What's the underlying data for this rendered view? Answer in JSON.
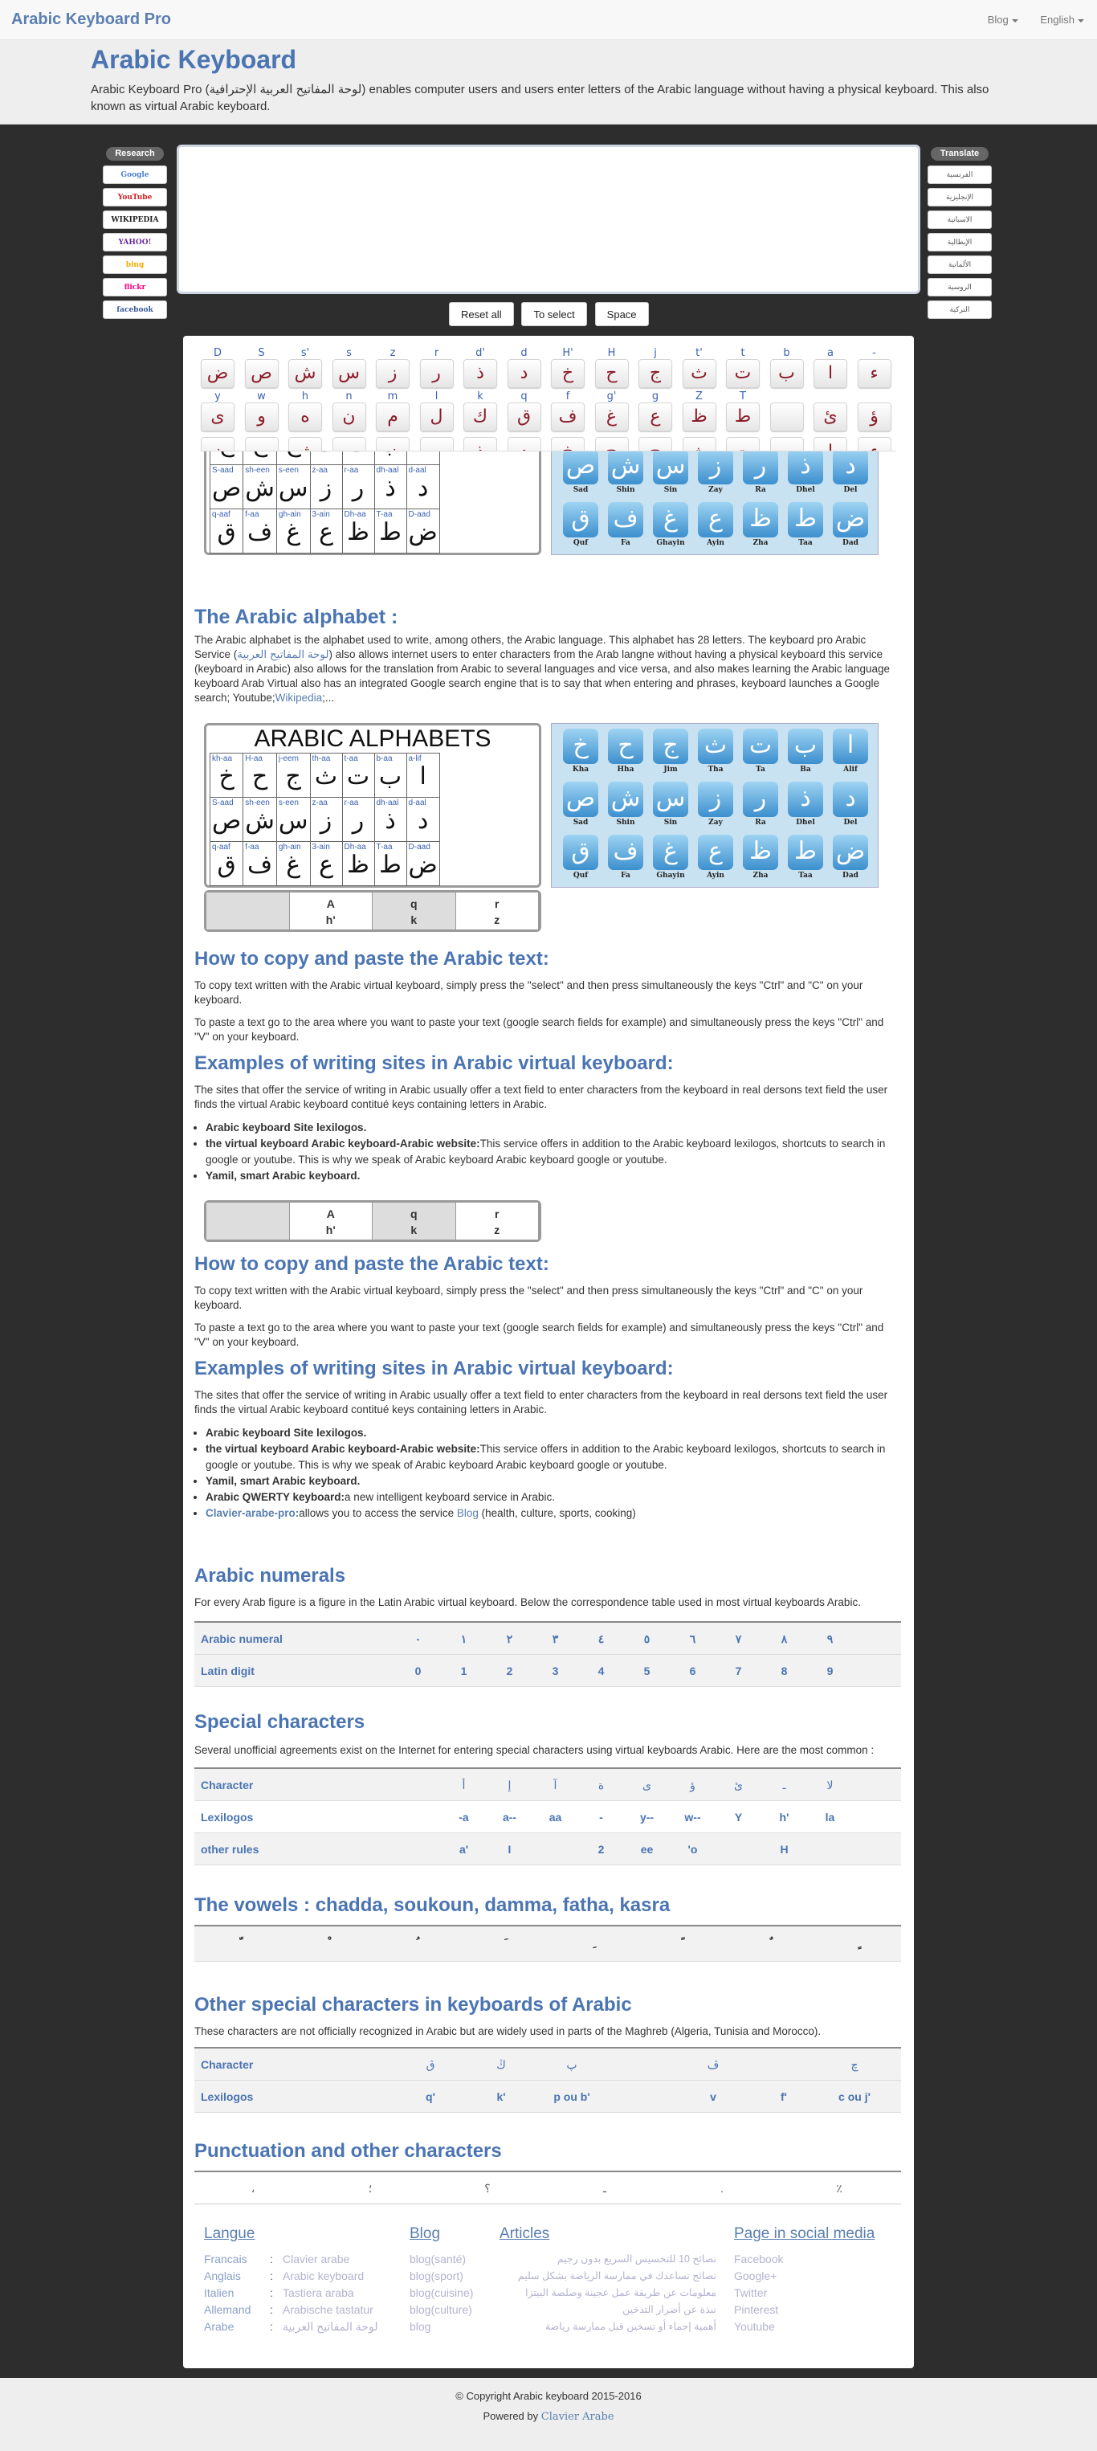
{
  "nav": {
    "brand": "Arabic Keyboard Pro",
    "blog": "Blog",
    "lang": "English"
  },
  "hero": {
    "title": "Arabic Keyboard",
    "desc": "Arabic Keyboard Pro (لوحة المفاتيح العربية الإحترافية) enables computer users and users enter letters of the Arabic language without having a physical keyboard. This also known as virtual Arabic keyboard."
  },
  "research": {
    "label": "Research",
    "items": [
      "Google",
      "YouTube",
      "WIKIPEDIA",
      "YAHOO!",
      "bing",
      "flickr",
      "facebook"
    ]
  },
  "translate": {
    "label": "Translate",
    "items": [
      "الفرنسية",
      "الإنجليزية",
      "الاسبانية",
      "الإيطالية",
      "الألمانية",
      "الروسية",
      "التركية"
    ]
  },
  "buttons": {
    "reset": "Reset all",
    "select": "To select",
    "space": "Space"
  },
  "keyboard": {
    "row1": [
      [
        "D",
        "ض"
      ],
      [
        "S",
        "ص"
      ],
      [
        "s'",
        "ش"
      ],
      [
        "s",
        "س"
      ],
      [
        "z",
        "ز"
      ],
      [
        "r",
        "ر"
      ],
      [
        "d'",
        "ذ"
      ],
      [
        "d",
        "د"
      ],
      [
        "H'",
        "خ"
      ],
      [
        "H",
        "ح"
      ],
      [
        "j",
        "ج"
      ],
      [
        "t'",
        "ث"
      ],
      [
        "t",
        "ت"
      ],
      [
        "b",
        "ب"
      ],
      [
        "a",
        "ا"
      ],
      [
        "-",
        "ء"
      ]
    ],
    "row2": [
      [
        "y",
        "ى"
      ],
      [
        "w",
        "و"
      ],
      [
        "h",
        "ه"
      ],
      [
        "n",
        "ن"
      ],
      [
        "m",
        "م"
      ],
      [
        "l",
        "ل"
      ],
      [
        "k",
        "ك"
      ],
      [
        "q",
        "ق"
      ],
      [
        "f",
        "ف"
      ],
      [
        "g'",
        "غ"
      ],
      [
        "g",
        "ع"
      ],
      [
        "Z",
        "ظ"
      ],
      [
        "T",
        "ط"
      ],
      [
        "",
        ""
      ],
      [
        "",
        "ئ"
      ],
      [
        "",
        "ؤ"
      ]
    ]
  },
  "alphabet_img": {
    "title": "ARABIC ALPHABETS",
    "rows": [
      [
        [
          "kh-aa",
          "خ"
        ],
        [
          "H-aa",
          "ح"
        ],
        [
          "j-eem",
          "ج"
        ],
        [
          "th-aa",
          "ث"
        ],
        [
          "t-aa",
          "ت"
        ],
        [
          "b-aa",
          "ب"
        ],
        [
          "a-lif",
          "ا"
        ]
      ],
      [
        [
          "S-aad",
          "ص"
        ],
        [
          "sh-een",
          "ش"
        ],
        [
          "s-een",
          "س"
        ],
        [
          "z-aa",
          "ز"
        ],
        [
          "r-aa",
          "ر"
        ],
        [
          "dh-aal",
          "ذ"
        ],
        [
          "d-aal",
          "د"
        ]
      ],
      [
        [
          "q-aaf",
          "ق"
        ],
        [
          "f-aa",
          "ف"
        ],
        [
          "gh-ain",
          "غ"
        ],
        [
          "3-ain",
          "ع"
        ],
        [
          "Dh-aa",
          "ظ"
        ],
        [
          "T-aa",
          "ط"
        ],
        [
          "D-aad",
          "ض"
        ]
      ]
    ],
    "blue_rows": [
      [
        [
          "خ",
          "Kha"
        ],
        [
          "ح",
          "Hha"
        ],
        [
          "ج",
          "Jim"
        ],
        [
          "ث",
          "Tha"
        ],
        [
          "ت",
          "Ta"
        ],
        [
          "ب",
          "Ba"
        ],
        [
          "ا",
          "Alif"
        ]
      ],
      [
        [
          "ص",
          "Sad"
        ],
        [
          "ش",
          "Shin"
        ],
        [
          "س",
          "Sin"
        ],
        [
          "ز",
          "Zay"
        ],
        [
          "ر",
          "Ra"
        ],
        [
          "ذ",
          "Dhel"
        ],
        [
          "د",
          "Del"
        ]
      ],
      [
        [
          "ق",
          "Quf"
        ],
        [
          "ف",
          "Fa"
        ],
        [
          "غ",
          "Ghayin"
        ],
        [
          "ع",
          "Ayin"
        ],
        [
          "ظ",
          "Zha"
        ],
        [
          "ط",
          "Taa"
        ],
        [
          "ض",
          "Dad"
        ]
      ]
    ],
    "strip": [
      "A",
      "h'",
      "q",
      "k",
      "r",
      "z"
    ]
  },
  "s1": {
    "title": "The Arabic alphabet :",
    "text_a": "The Arabic alphabet is the alphabet used to write, among others, the Arabic language. This alphabet has 28 letters. The keyboard pro Arabic Service (",
    "link": "لوحة المفاتيح العربية",
    "text_b": ") also allows internet users to enter characters from the Arab langne without having a physical keyboard this service (keyboard in Arabic) also allows for the translation from Arabic to several languages and vice versa, and also makes learning the Arabic language keyboard Arab Virtual also has an integrated Google search engine that is to say that when entering and phrases, keyboard launches a Google search; Youtube;",
    "wiki": "Wikipedia",
    "tail": ";..."
  },
  "s2": {
    "title": "How to copy and paste the Arabic text:",
    "p1": "To copy text written with the Arabic virtual keyboard, simply press the \"select\" and then press simultaneously the keys \"Ctrl\" and \"C\" on your keyboard.",
    "p2": "To paste a text go to the area where you want to paste your text (google search fields for example) and simultaneously press the keys \"Ctrl\" and \"V\" on your keyboard."
  },
  "s3": {
    "title": "Examples of writing sites in Arabic virtual keyboard:",
    "p": "The sites that offer the service of writing in Arabic usually offer a text field to enter characters from the keyboard in real dersons text field the user finds the virtual Arabic keyboard contitué keys containing letters in Arabic.",
    "li1": "Arabic keyboard Site lexilogos.",
    "li2b": "the virtual keyboard Arabic keyboard-Arabic website:",
    "li2": "This service offers in addition to the Arabic keyboard lexilogos, shortcuts to search in google or youtube. This is why we speak of Arabic keyboard Arabic keyboard google or youtube.",
    "li3": "Yamil, smart Arabic keyboard.",
    "li4b": "Arabic QWERTY keyboard:",
    "li4": "a new intelligent keyboard service in Arabic.",
    "li5b": "Clavier-arabe-pro:",
    "li5a": "allows you to access the service ",
    "li5l": "Blog",
    "li5c": " (health, culture, sports, cooking)"
  },
  "numerals": {
    "title": "Arabic numerals",
    "p": "For every Arab figure is a figure in the Latin Arabic virtual keyboard. Below the correspondence table used in most virtual keyboards Arabic.",
    "h1": "Arabic numeral",
    "h2": "Latin digit",
    "ar": [
      "٠",
      "١",
      "٢",
      "٣",
      "٤",
      "٥",
      "٦",
      "٧",
      "٨",
      "٩"
    ],
    "lat": [
      "0",
      "1",
      "2",
      "3",
      "4",
      "5",
      "6",
      "7",
      "8",
      "9"
    ]
  },
  "special": {
    "title": "Special characters",
    "p": "Several unofficial agreements exist on the Internet for entering special characters using virtual keyboards Arabic. Here are the most common :",
    "h1": "Character",
    "h2": "Lexilogos",
    "h3": "other rules",
    "c": [
      "",
      "أ",
      "إ",
      "آ",
      "ة",
      "ى",
      "ؤ",
      "ئ",
      "ـ",
      "لا"
    ],
    "lex": [
      "",
      "-a",
      "a--",
      "aa",
      "-",
      "y--",
      "w--",
      "Y",
      "h'",
      "la"
    ],
    "oth": [
      "",
      "a'",
      "I",
      "",
      "2",
      "ee",
      "'o",
      "",
      "H",
      ""
    ]
  },
  "vowels": {
    "title": "The vowels : chadda, soukoun, damma, fatha, kasra",
    "c": [
      "ّ",
      "ْ",
      "ُ",
      "َ",
      "ِ",
      "ً",
      "ٌ",
      "ٍ"
    ]
  },
  "other": {
    "title": "Other special characters in keyboards of Arabic",
    "p": "These characters are not officially recognized in Arabic but are widely used in parts of the Maghreb (Algeria, Tunisia and Morocco).",
    "h1": "Character",
    "h2": "Lexilogos",
    "c": [
      "ڨ",
      "ڭ",
      "پ",
      "",
      "ڤ",
      "",
      "چ"
    ],
    "lex": [
      "q'",
      "k'",
      "p ou b'",
      "",
      "v",
      "f'",
      "c ou j'"
    ]
  },
  "punct": {
    "title": "Punctuation and other characters",
    "c": [
      "،",
      "؛",
      "؟",
      "ـ",
      ".",
      "٪"
    ]
  },
  "footer": {
    "langue": "Langue",
    "blog": "Blog",
    "articles": "Articles",
    "social": "Page in social media",
    "langs": [
      [
        "Francais",
        "Clavier arabe"
      ],
      [
        "Anglais",
        "Arabic keyboard"
      ],
      [
        "Italien",
        "Tastiera araba"
      ],
      [
        "Allemand",
        "Arabische tastatur"
      ],
      [
        "Arabe",
        "لوحة المفاتيح العربية"
      ]
    ],
    "blogs": [
      "blog(santé)",
      "blog(sport)",
      "blog(cuisine)",
      "blog(culture)",
      "blog"
    ],
    "arts": [
      "نصائح 10 للتخسيس السريع بدون رجيم",
      "نصائح تساعدك في ممارسة الرياضة بشكل سليم",
      "معلومات عن طريقة عمل عجينة وصلصة البيتزا",
      "نبذة عن أضرار التدخين",
      "أهمية إجماء أو تسخين قبل ممارسة رياضة"
    ],
    "socials": [
      "Facebook",
      "Google+",
      "Twitter",
      "Pinterest",
      "Youtube"
    ]
  },
  "copyright": "© Copyright Arabic keyboard 2015-2016",
  "powered": "Powered by",
  "powered_link": "Clavier Arabe"
}
